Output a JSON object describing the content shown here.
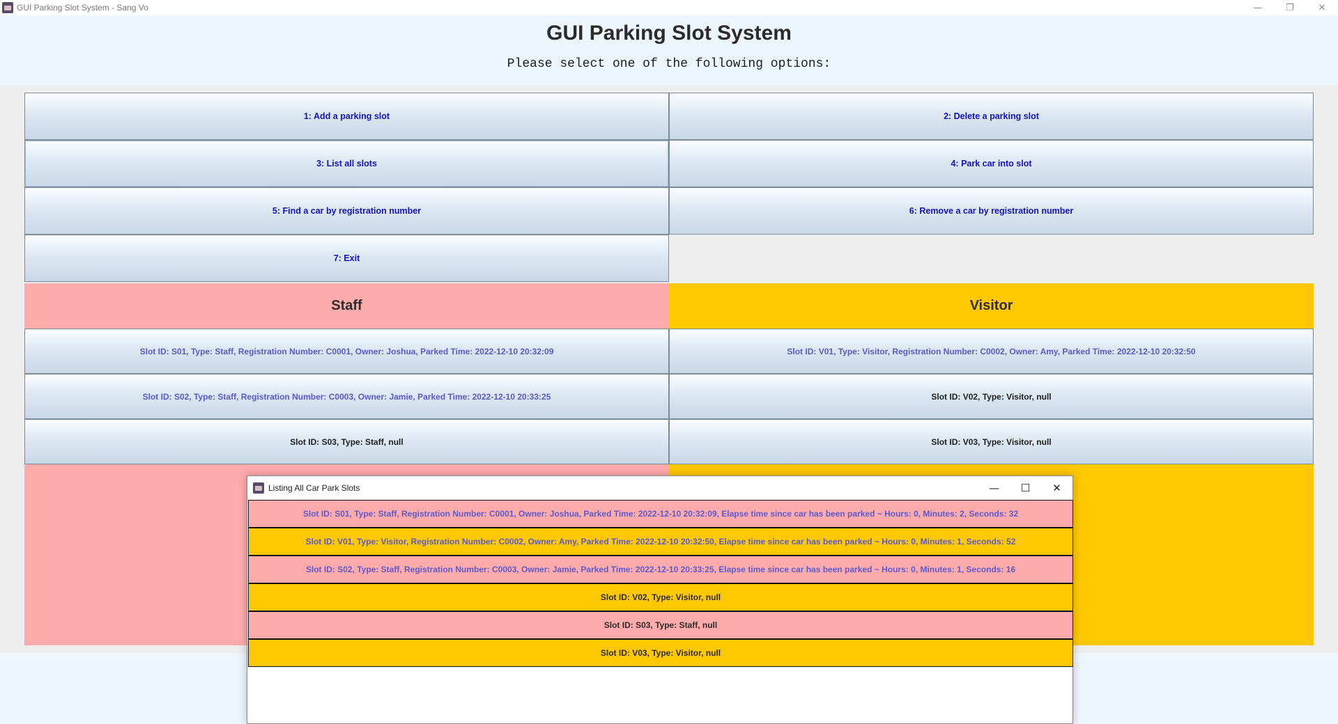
{
  "window": {
    "title": "GUI Parking Slot System - Sang Vo",
    "controls": {
      "minimize": "—",
      "restore": "❐",
      "close": "✕"
    }
  },
  "header": {
    "title": "GUI Parking Slot System",
    "subtitle": "Please select one of the following options:"
  },
  "menu": {
    "add": "1: Add a parking slot",
    "delete": "2: Delete a parking slot",
    "list": "3: List all slots",
    "park": "4: Park car into slot",
    "find": "5: Find a car by registration number",
    "remove": "6: Remove a car by registration number",
    "exit": "7: Exit"
  },
  "colors": {
    "staff": "#ffabab",
    "visitor": "#ffc800",
    "button_text": "#1212c8",
    "occupied_text": "#5a5acc"
  },
  "staff": {
    "heading": "Staff",
    "slots": [
      "Slot ID: S01, Type: Staff, Registration Number: C0001, Owner: Joshua, Parked Time: 2022-12-10 20:32:09",
      "Slot ID: S02, Type: Staff, Registration Number: C0003, Owner: Jamie, Parked Time: 2022-12-10 20:33:25",
      "Slot ID: S03, Type: Staff, null"
    ]
  },
  "visitor": {
    "heading": "Visitor",
    "slots": [
      "Slot ID: V01, Type: Visitor, Registration Number: C0002, Owner: Amy, Parked Time: 2022-12-10 20:32:50",
      "Slot ID: V02, Type: Visitor, null",
      "Slot ID: V03, Type: Visitor, null"
    ]
  },
  "dialog": {
    "title": "Listing All Car Park Slots",
    "controls": {
      "minimize": "—",
      "maximize": "☐",
      "close": "✕"
    },
    "rows": [
      "Slot ID: S01, Type: Staff, Registration Number: C0001, Owner: Joshua, Parked Time: 2022-12-10 20:32:09, Elapse time since car has been parked ~ Hours: 0, Minutes: 2, Seconds: 32",
      "Slot ID: V01, Type: Visitor, Registration Number: C0002, Owner: Amy, Parked Time: 2022-12-10 20:32:50, Elapse time since car has been parked ~ Hours: 0, Minutes: 1, Seconds: 52",
      "Slot ID: S02, Type: Staff, Registration Number: C0003, Owner: Jamie, Parked Time: 2022-12-10 20:33:25, Elapse time since car has been parked ~ Hours: 0, Minutes: 1, Seconds: 16",
      "Slot ID: V02, Type: Visitor, null",
      "Slot ID: S03, Type: Staff, null",
      "Slot ID: V03, Type: Visitor, null"
    ]
  }
}
